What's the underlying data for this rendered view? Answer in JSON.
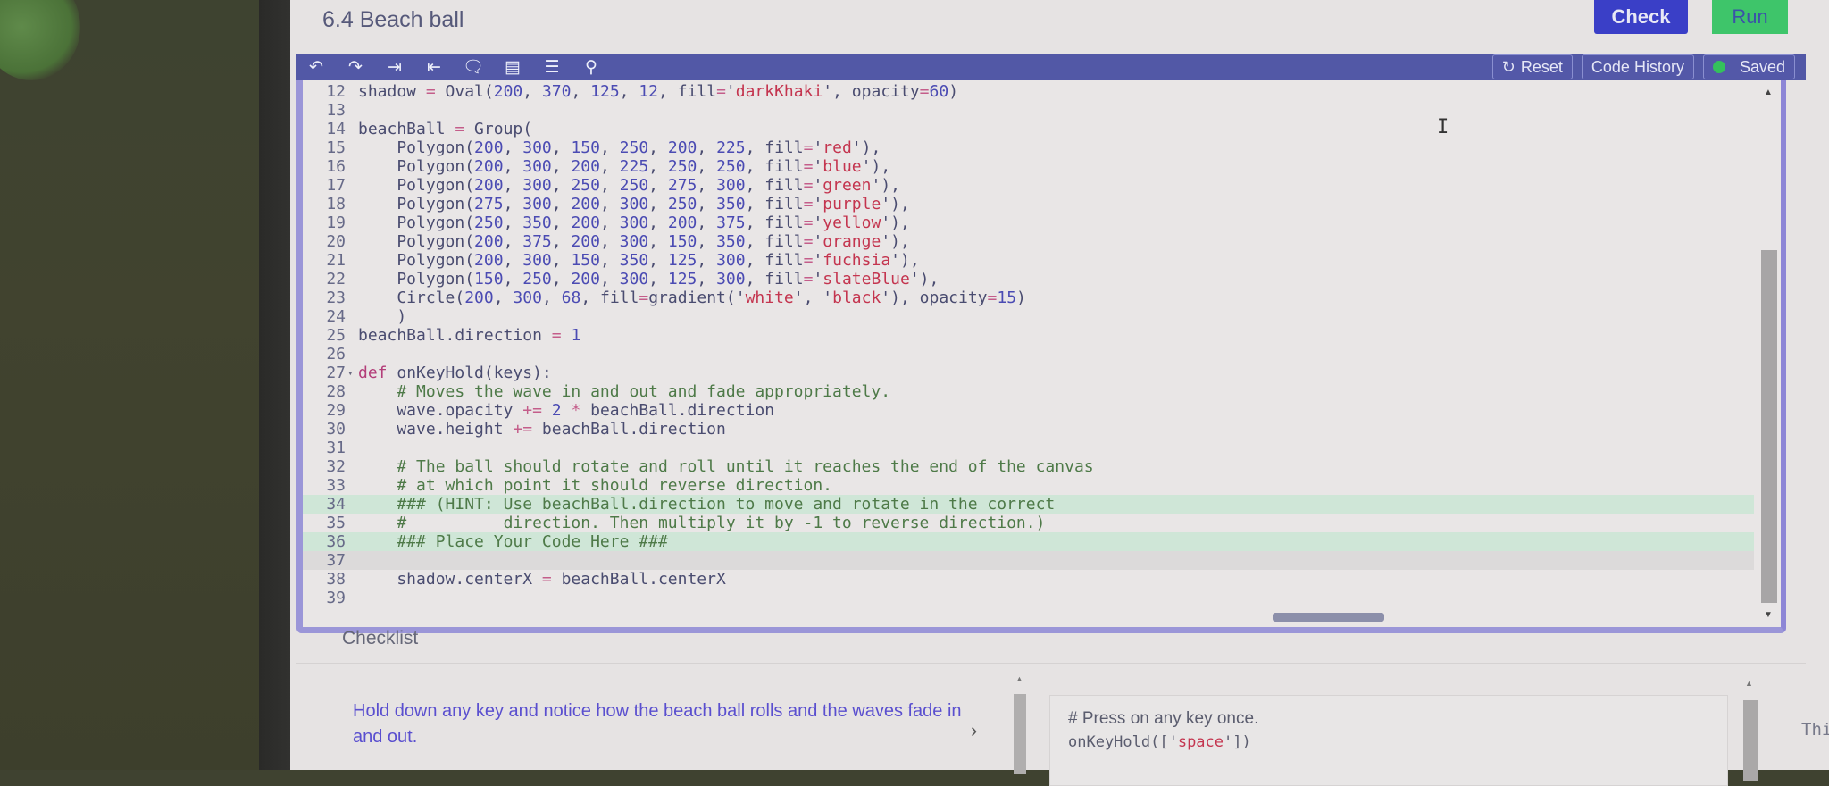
{
  "page": {
    "title": "6.4 Beach ball"
  },
  "actions": {
    "check_label": "Check",
    "run_label": "Run"
  },
  "toolbar": {
    "icons": [
      "undo-icon",
      "redo-icon",
      "indent-icon",
      "outdent-icon",
      "comment-icon",
      "format-icon",
      "fold-icon",
      "search-icon"
    ],
    "reset_label": "Reset",
    "code_history_label": "Code History",
    "saved_label": "Saved"
  },
  "editor": {
    "lines": [
      {
        "n": "12",
        "text": "shadow = Oval(200, 370, 125, 12, fill='darkKhaki', opacity=60)"
      },
      {
        "n": "13",
        "text": ""
      },
      {
        "n": "14",
        "text": "beachBall = Group("
      },
      {
        "n": "15",
        "text": "    Polygon(200, 300, 150, 250, 200, 225, fill='red'),"
      },
      {
        "n": "16",
        "text": "    Polygon(200, 300, 200, 225, 250, 250, fill='blue'),"
      },
      {
        "n": "17",
        "text": "    Polygon(200, 300, 250, 250, 275, 300, fill='green'),"
      },
      {
        "n": "18",
        "text": "    Polygon(275, 300, 200, 300, 250, 350, fill='purple'),"
      },
      {
        "n": "19",
        "text": "    Polygon(250, 350, 200, 300, 200, 375, fill='yellow'),"
      },
      {
        "n": "20",
        "text": "    Polygon(200, 375, 200, 300, 150, 350, fill='orange'),"
      },
      {
        "n": "21",
        "text": "    Polygon(200, 300, 150, 350, 125, 300, fill='fuchsia'),"
      },
      {
        "n": "22",
        "text": "    Polygon(150, 250, 200, 300, 125, 300, fill='slateBlue'),"
      },
      {
        "n": "23",
        "text": "    Circle(200, 300, 68, fill=gradient('white', 'black'), opacity=15)"
      },
      {
        "n": "24",
        "text": "    )"
      },
      {
        "n": "25",
        "text": "beachBall.direction = 1"
      },
      {
        "n": "26",
        "text": ""
      },
      {
        "n": "27",
        "text": "def onKeyHold(keys):",
        "fold": true
      },
      {
        "n": "28",
        "text": "    # Moves the wave in and out and fade appropriately."
      },
      {
        "n": "29",
        "text": "    wave.opacity += 2 * beachBall.direction"
      },
      {
        "n": "30",
        "text": "    wave.height += beachBall.direction"
      },
      {
        "n": "31",
        "text": ""
      },
      {
        "n": "32",
        "text": "    # The ball should rotate and roll until it reaches the end of the canvas"
      },
      {
        "n": "33",
        "text": "    # at which point it should reverse direction."
      },
      {
        "n": "34",
        "text": "    ### (HINT: Use beachBall.direction to move and rotate in the correct",
        "highlight": "green"
      },
      {
        "n": "35",
        "text": "    #          direction. Then multiply it by -1 to reverse direction.)"
      },
      {
        "n": "36",
        "text": "    ### Place Your Code Here ###",
        "highlight": "green"
      },
      {
        "n": "37",
        "text": "",
        "highlight": "gray"
      },
      {
        "n": "38",
        "text": "    shadow.centerX = beachBall.centerX"
      },
      {
        "n": "39",
        "text": ""
      }
    ]
  },
  "checklist": {
    "label": "Checklist",
    "items": [
      {
        "text": "Hold down any key and notice how the beach ball rolls and the waves fade in and out."
      }
    ],
    "code_comment": "# Press on any key once.",
    "code_line": "onKeyHold(['space'])",
    "truncated_text": "Thi"
  },
  "colors": {
    "toolbar_bg": "#5258a6",
    "check_button": "#3a3fc7",
    "run_button": "#3ec56a",
    "saved_indicator": "#34c15c",
    "checklist_item_text": "#5a4fcf",
    "editor_border": "#9b96d8",
    "hint_highlight": "#cfe6d7"
  }
}
